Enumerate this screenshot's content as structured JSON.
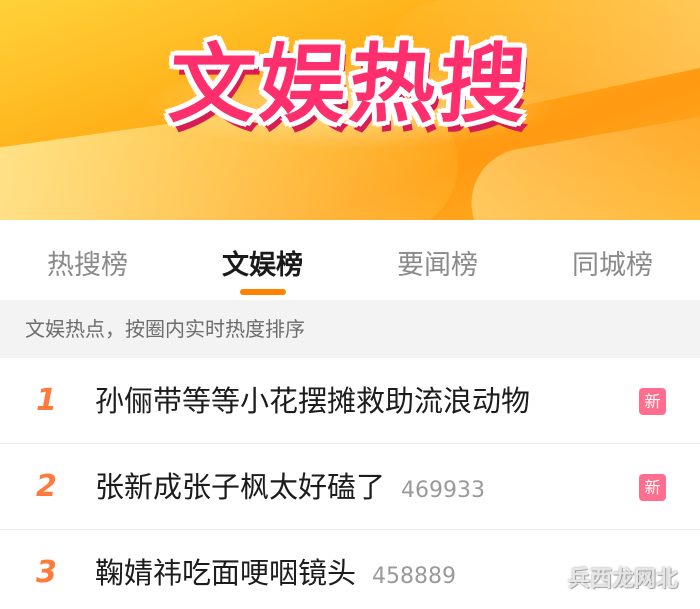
{
  "banner": {
    "title": "文娱热搜"
  },
  "tabs": [
    {
      "label": "热搜榜",
      "active": false
    },
    {
      "label": "文娱榜",
      "active": true
    },
    {
      "label": "要闻榜",
      "active": false
    },
    {
      "label": "同城榜",
      "active": false
    }
  ],
  "hint": "文娱热点，按圈内实时热度排序",
  "list": [
    {
      "rank": "1",
      "title": "孙俪带等等小花摆摊救助流浪动物",
      "count": "",
      "badge": "新"
    },
    {
      "rank": "2",
      "title": "张新成张子枫太好磕了",
      "count": "469933",
      "badge": "新"
    },
    {
      "rank": "3",
      "title": "鞠婧祎吃面哽咽镜头",
      "count": "458889",
      "badge": ""
    }
  ],
  "watermark": "兵西龙网北",
  "colors": {
    "accent": "#ff8200",
    "rank": "#ff7a3d",
    "badge": "#ff6e8e",
    "banner_title": "#ff2f6e"
  }
}
